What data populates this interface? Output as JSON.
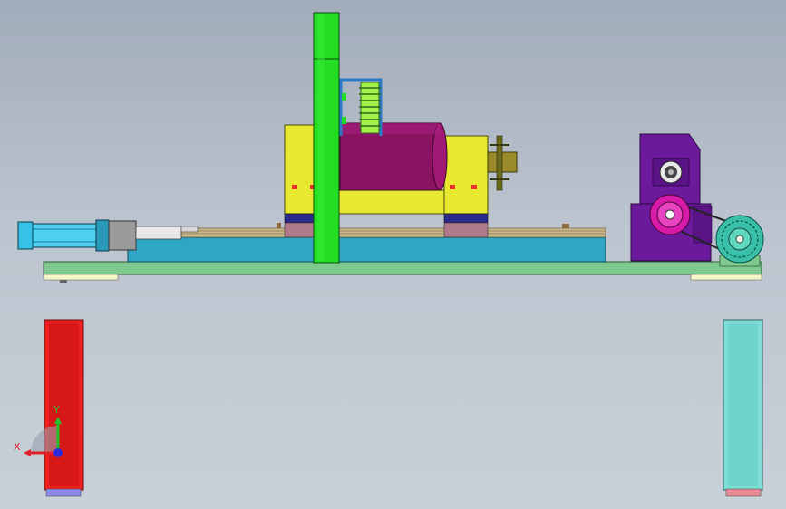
{
  "viewport": {
    "background_top": "#a1acba",
    "background_bottom": "#c9d0d8"
  },
  "triad": {
    "x_label": "X",
    "y_label": "Y",
    "x_color": "#e0202a",
    "y_color": "#22c32a",
    "z_color": "#2a2ad8"
  },
  "colors": {
    "base_plate": "#7fc98f",
    "slide_table": "#2fa6c4",
    "column": "#22dd22",
    "housing": "#e8e830",
    "drum": "#8a1462",
    "gearbox": "#6a1a9a",
    "pulley": "#d81aa8",
    "motor": "#3ac0a8",
    "cylinder": "#35c2e6",
    "leg_left": "#ee2020",
    "leg_right": "#7fdfd6"
  }
}
